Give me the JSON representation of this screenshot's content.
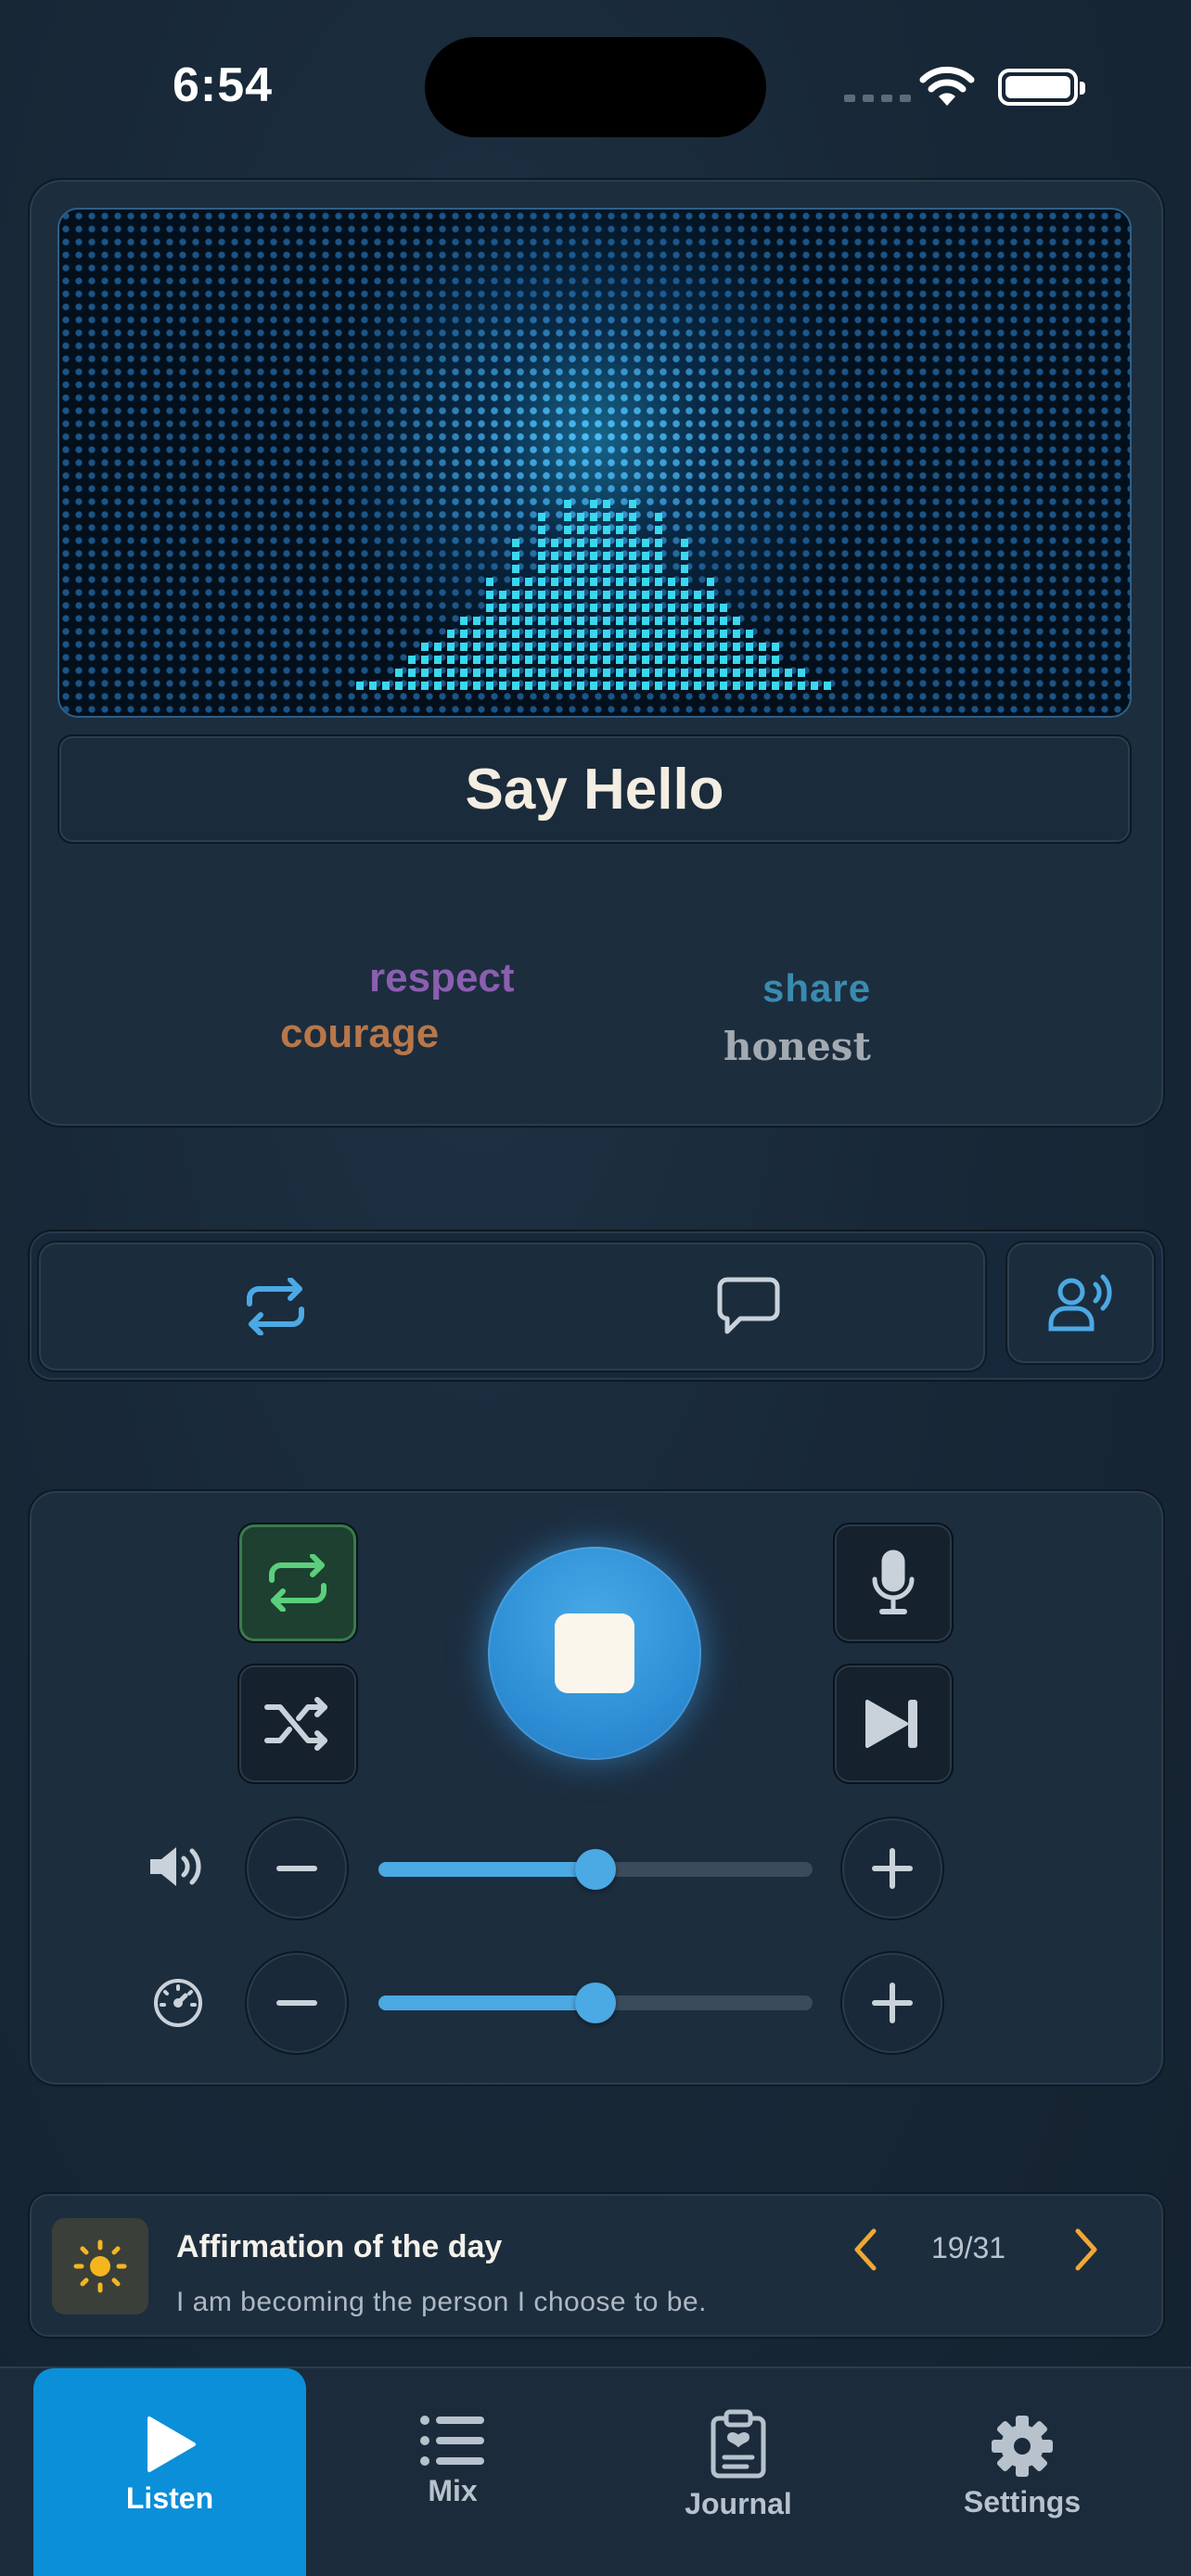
{
  "status_bar": {
    "time": "6:54"
  },
  "now_playing": {
    "title": "Say Hello",
    "words": [
      "respect",
      "courage",
      "share",
      "honest"
    ]
  },
  "mode_bar": {
    "icons": [
      "repeat-icon",
      "speech-bubble-icon",
      "voice-speaker-icon"
    ]
  },
  "controls": {
    "repeat_active": true,
    "playback_state": "playing",
    "volume_level": 0.5,
    "speed_level": 0.5
  },
  "affirmation": {
    "title": "Affirmation of the day",
    "text": "I am becoming the person I choose to be.",
    "counter": "19/31"
  },
  "tabs": [
    {
      "label": "Listen",
      "icon": "play-icon",
      "active": true
    },
    {
      "label": "Mix",
      "icon": "list-icon",
      "active": false
    },
    {
      "label": "Journal",
      "icon": "clipboard-heart-icon",
      "active": false
    },
    {
      "label": "Settings",
      "icon": "gear-icon",
      "active": false
    }
  ],
  "colors": {
    "accent": "#0b8fd9",
    "slider": "#4ba9e4",
    "repeat_active": "#3c7a4e",
    "affirmation_arrow": "#f0a832",
    "sun": "#f5b51f"
  }
}
